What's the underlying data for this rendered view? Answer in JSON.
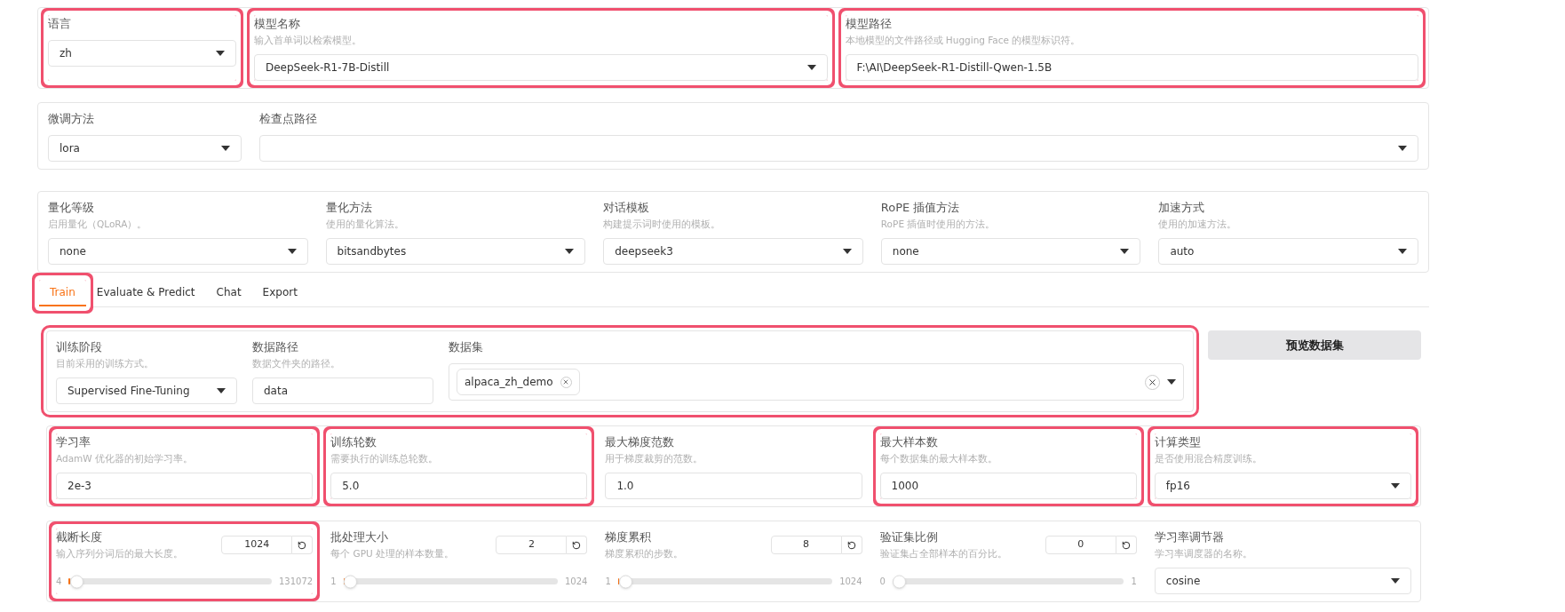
{
  "model_settings": [
    {
      "kind": "dropdown",
      "label": "语言",
      "value": "zh",
      "highlighted": true
    },
    {
      "kind": "dropdown",
      "label": "模型名称",
      "hint": "输入首单词以检索模型。",
      "value": "DeepSeek-R1-7B-Distill",
      "highlighted": true
    },
    {
      "kind": "text",
      "label": "模型路径",
      "hint": "本地模型的文件路径或 Hugging Face 的模型标识符。",
      "value": "F:\\AI\\DeepSeek-R1-Distill-Qwen-1.5B",
      "highlighted": true
    }
  ],
  "finetune_settings": [
    {
      "kind": "dropdown",
      "label": "微调方法",
      "value": "lora",
      "highlighted": false
    },
    {
      "kind": "dropdown",
      "label": "检查点路径",
      "highlighted": false
    }
  ],
  "advanced_settings": [
    {
      "kind": "dropdown",
      "label": "量化等级",
      "hint": "启用量化（QLoRA）。",
      "value": "none",
      "highlighted": false
    },
    {
      "kind": "dropdown",
      "label": "量化方法",
      "hint": "使用的量化算法。",
      "value": "bitsandbytes",
      "highlighted": false
    },
    {
      "kind": "dropdown",
      "label": "对话模板",
      "hint": "构建提示词时使用的模板。",
      "value": "deepseek3",
      "highlighted": false
    },
    {
      "kind": "dropdown",
      "label": "RoPE 插值方法",
      "hint": "RoPE 插值时使用的方法。",
      "value": "none",
      "highlighted": false
    },
    {
      "kind": "dropdown",
      "label": "加速方式",
      "hint": "使用的加速方法。",
      "value": "auto",
      "highlighted": false
    }
  ],
  "tabs": [
    {
      "label": "Train",
      "selected": true,
      "highlighted": true
    },
    {
      "label": "Evaluate & Predict",
      "selected": false,
      "highlighted": false
    },
    {
      "label": "Chat",
      "selected": false,
      "highlighted": false
    },
    {
      "label": "Export",
      "selected": false,
      "highlighted": false
    }
  ],
  "train": {
    "data_row": {
      "highlighted": true,
      "fields": [
        {
          "kind": "dropdown",
          "label": "训练阶段",
          "hint": "目前采用的训练方式。",
          "value": "Supervised Fine-Tuning"
        },
        {
          "kind": "text",
          "label": "数据路径",
          "hint": "数据文件夹的路径。",
          "value": "data"
        },
        {
          "kind": "multiselect",
          "label": "数据集",
          "chips": [
            "alpaca_zh_demo"
          ]
        }
      ]
    },
    "preview_button": "预览数据集",
    "hyper_row": [
      {
        "kind": "text",
        "label": "学习率",
        "hint": "AdamW 优化器的初始学习率。",
        "value": "2e-3",
        "highlighted": true
      },
      {
        "kind": "text",
        "label": "训练轮数",
        "hint": "需要执行的训练总轮数。",
        "value": "5.0",
        "highlighted": true
      },
      {
        "kind": "text",
        "label": "最大梯度范数",
        "hint": "用于梯度裁剪的范数。",
        "value": "1.0",
        "highlighted": false
      },
      {
        "kind": "text",
        "label": "最大样本数",
        "hint": "每个数据集的最大样本数。",
        "value": "1000",
        "highlighted": true
      },
      {
        "kind": "dropdown",
        "label": "计算类型",
        "hint": "是否使用混合精度训练。",
        "value": "fp16",
        "highlighted": true
      }
    ],
    "slider_row": [
      {
        "kind": "slider",
        "label": "截断长度",
        "hint": "输入序列分词后的最大长度。",
        "value": "1024",
        "min": "4",
        "max": "131072",
        "level": 0.008,
        "highlighted": true
      },
      {
        "kind": "slider",
        "label": "批处理大小",
        "hint": "每个 GPU 处理的样本数量。",
        "value": "2",
        "min": "1",
        "max": "1024",
        "level": 0.001,
        "highlighted": false
      },
      {
        "kind": "slider",
        "label": "梯度累积",
        "hint": "梯度累积的步数。",
        "value": "8",
        "min": "1",
        "max": "1024",
        "level": 0.007,
        "highlighted": false
      },
      {
        "kind": "slider",
        "label": "验证集比例",
        "hint": "验证集占全部样本的百分比。",
        "value": "0",
        "min": "0",
        "max": "1",
        "level": 0,
        "highlighted": false
      },
      {
        "kind": "dropdown",
        "label": "学习率调节器",
        "hint": "学习率调度器的名称。",
        "value": "cosine",
        "highlighted": false
      }
    ]
  }
}
